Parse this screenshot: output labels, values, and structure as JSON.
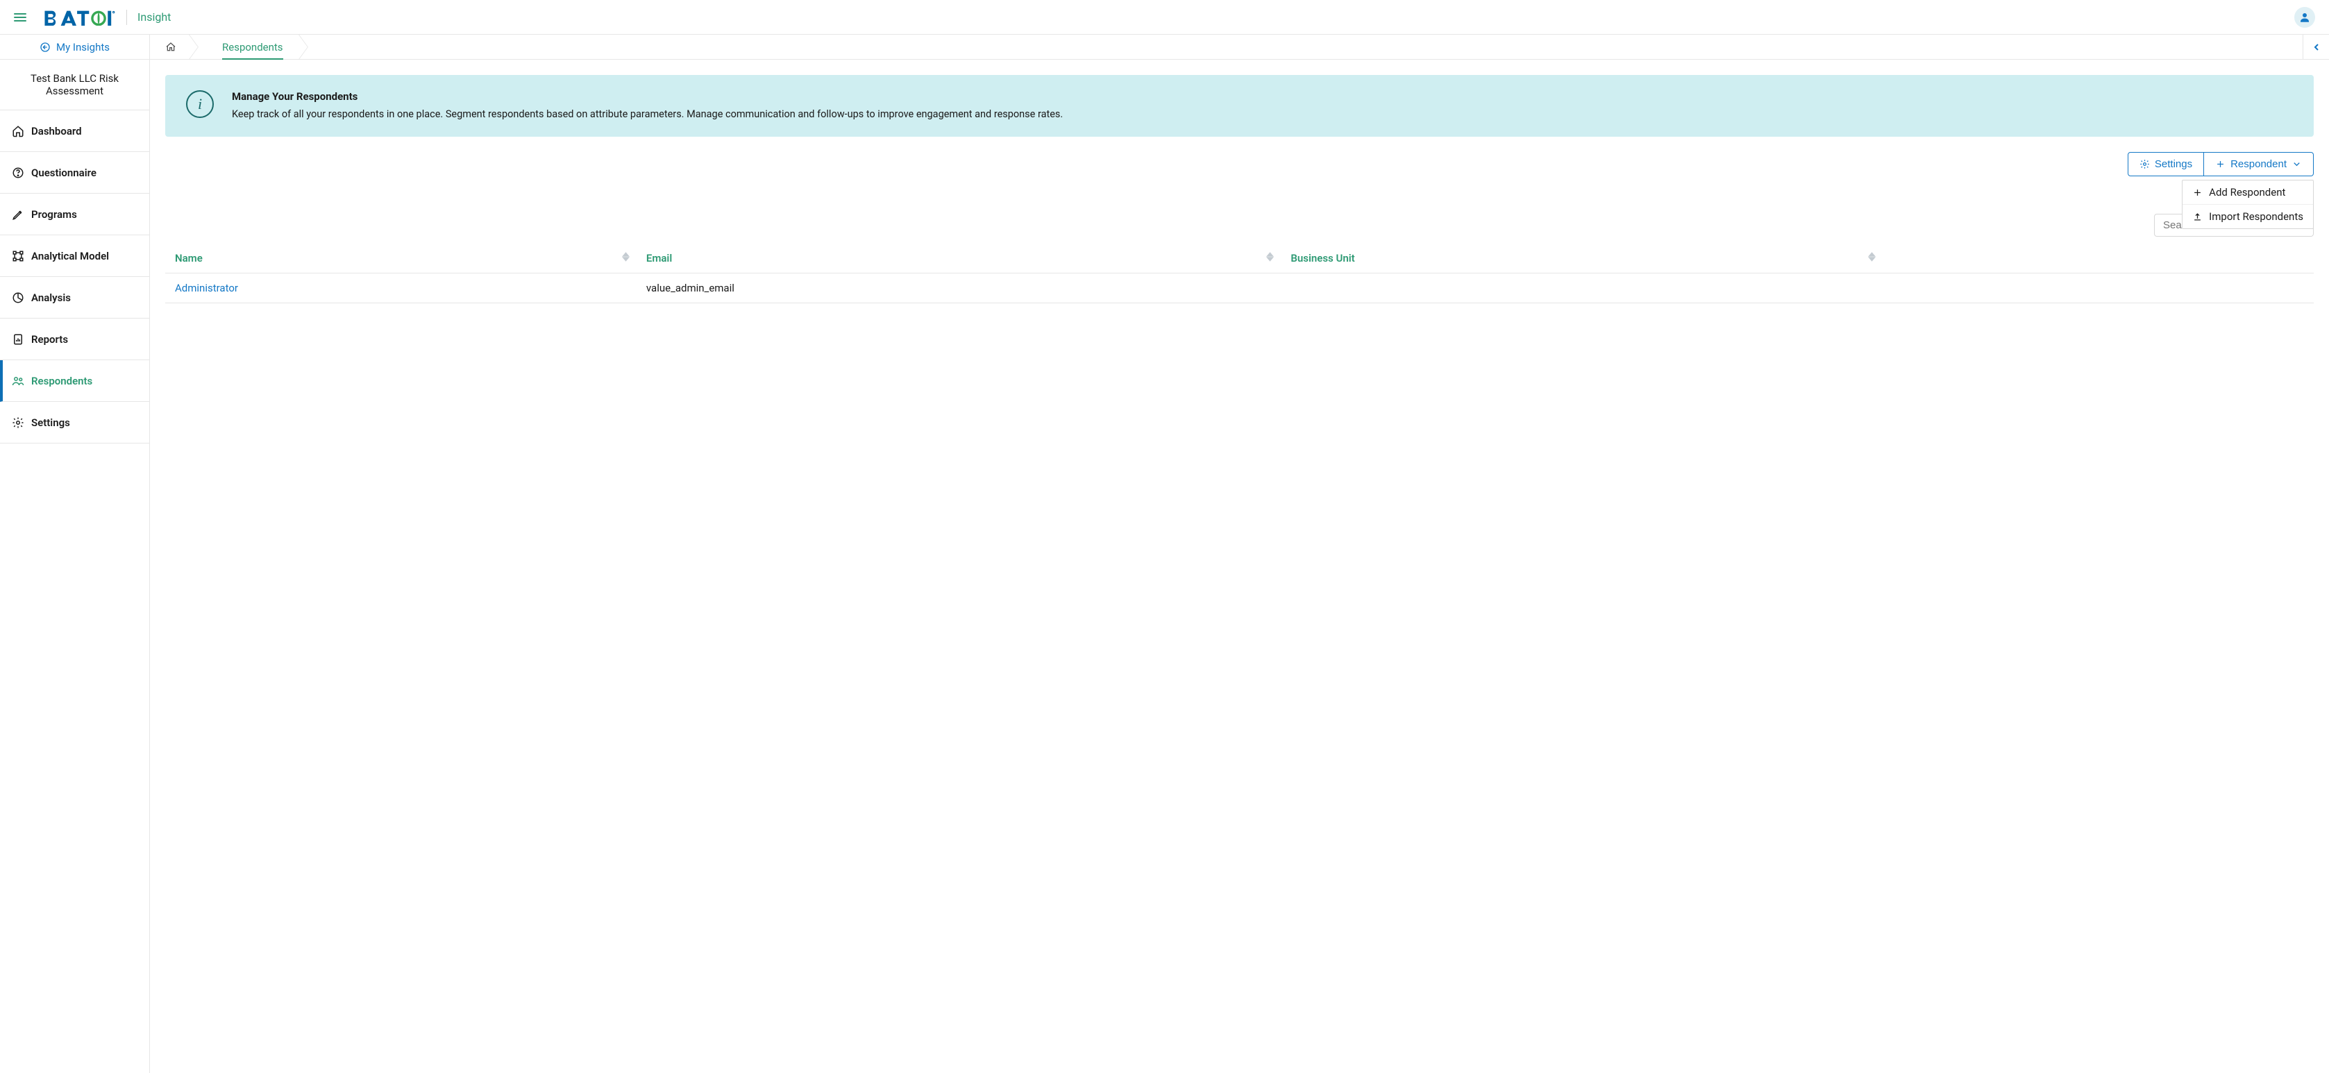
{
  "brand": {
    "product": "Insight"
  },
  "header": {
    "my_insights": "My Insights"
  },
  "avatar": {
    "name": "user-avatar"
  },
  "sidebar": {
    "project": "Test Bank LLC Risk Assessment",
    "items": [
      {
        "id": "dashboard",
        "label": "Dashboard",
        "icon": "home"
      },
      {
        "id": "questionnaire",
        "label": "Questionnaire",
        "icon": "question"
      },
      {
        "id": "programs",
        "label": "Programs",
        "icon": "pen"
      },
      {
        "id": "analytical-model",
        "label": "Analytical Model",
        "icon": "nodes"
      },
      {
        "id": "analysis",
        "label": "Analysis",
        "icon": "pie"
      },
      {
        "id": "reports",
        "label": "Reports",
        "icon": "doc-bar"
      },
      {
        "id": "respondents",
        "label": "Respondents",
        "icon": "people",
        "active": true
      },
      {
        "id": "settings",
        "label": "Settings",
        "icon": "gear"
      }
    ]
  },
  "breadcrumb": {
    "current": "Respondents"
  },
  "info": {
    "title": "Manage Your Respondents",
    "body": "Keep track of all your respondents in one place. Segment respondents based on attribute parameters. Manage communication and follow-ups to improve engagement and response rates."
  },
  "toolbar": {
    "settings": "Settings",
    "add_respondent": "Respondent",
    "menu": {
      "add": "Add Respondent",
      "import": "Import Respondents"
    }
  },
  "search": {
    "placeholder": "Search"
  },
  "table": {
    "columns": {
      "name": "Name",
      "email": "Email",
      "business_unit": "Business Unit"
    },
    "rows": [
      {
        "name": "Administrator",
        "email": "value_admin_email",
        "business_unit": ""
      }
    ]
  },
  "colors": {
    "accent_green": "#2e9a74",
    "accent_blue": "#1478c6",
    "info_bg": "#cfeef1"
  }
}
